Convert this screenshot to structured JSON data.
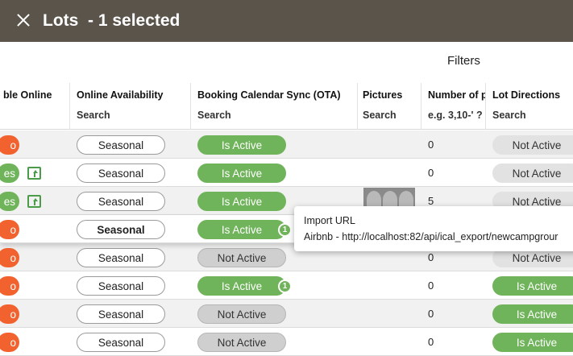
{
  "topbar": {
    "close_icon": "close-icon",
    "title": "Lots  - 1 selected"
  },
  "filters_label": "Filters",
  "columns": [
    {
      "label": "ble Online",
      "search": ""
    },
    {
      "label": "Online Availability",
      "search": "Search"
    },
    {
      "label": "Booking Calendar Sync (OTA)",
      "search": "Search"
    },
    {
      "label": "Pictures",
      "search": "Search"
    },
    {
      "label": "Number of p",
      "search": "e.g. 3,10-' ?"
    },
    {
      "label": "Lot Directions",
      "search": "Search"
    }
  ],
  "rows": [
    {
      "online": "o",
      "online_color": "#f2622e",
      "availability": "Seasonal",
      "sync": "Is Active",
      "badge": "",
      "number": "0",
      "directions": "Not Active"
    },
    {
      "online": "es",
      "online_color": "#6fb35a",
      "availability": "Seasonal",
      "sync": "Is Active",
      "badge": "",
      "number": "0",
      "directions": "Not Active"
    },
    {
      "online": "es",
      "online_color": "#6fb35a",
      "availability": "Seasonal",
      "sync": "Is Active",
      "badge": "",
      "number": "5",
      "directions": "Not Active"
    },
    {
      "online": "o",
      "online_color": "#f2622e",
      "availability": "Seasonal",
      "sync": "Is Active",
      "badge": "1",
      "number": "",
      "directions": ""
    },
    {
      "online": "o",
      "online_color": "#f2622e",
      "availability": "Seasonal",
      "sync": "Not Active",
      "badge": "",
      "number": "0",
      "directions": "Not Active"
    },
    {
      "online": "o",
      "online_color": "#f2622e",
      "availability": "Seasonal",
      "sync": "Is Active",
      "badge": "1",
      "number": "0",
      "directions": "Is Active"
    },
    {
      "online": "o",
      "online_color": "#f2622e",
      "availability": "Seasonal",
      "sync": "Not Active",
      "badge": "",
      "number": "0",
      "directions": "Is Active"
    },
    {
      "online": "o",
      "online_color": "#f2622e",
      "availability": "Seasonal",
      "sync": "Not Active",
      "badge": "",
      "number": "0",
      "directions": "Is Active"
    }
  ],
  "tooltip": {
    "title": "Import URL",
    "url": "Airbnb - http://localhost:82/api/ical_export/newcampgrour"
  },
  "colors": {
    "topbar": "#5a544b",
    "active_green": "#6fb35a",
    "orange": "#f2622e"
  }
}
